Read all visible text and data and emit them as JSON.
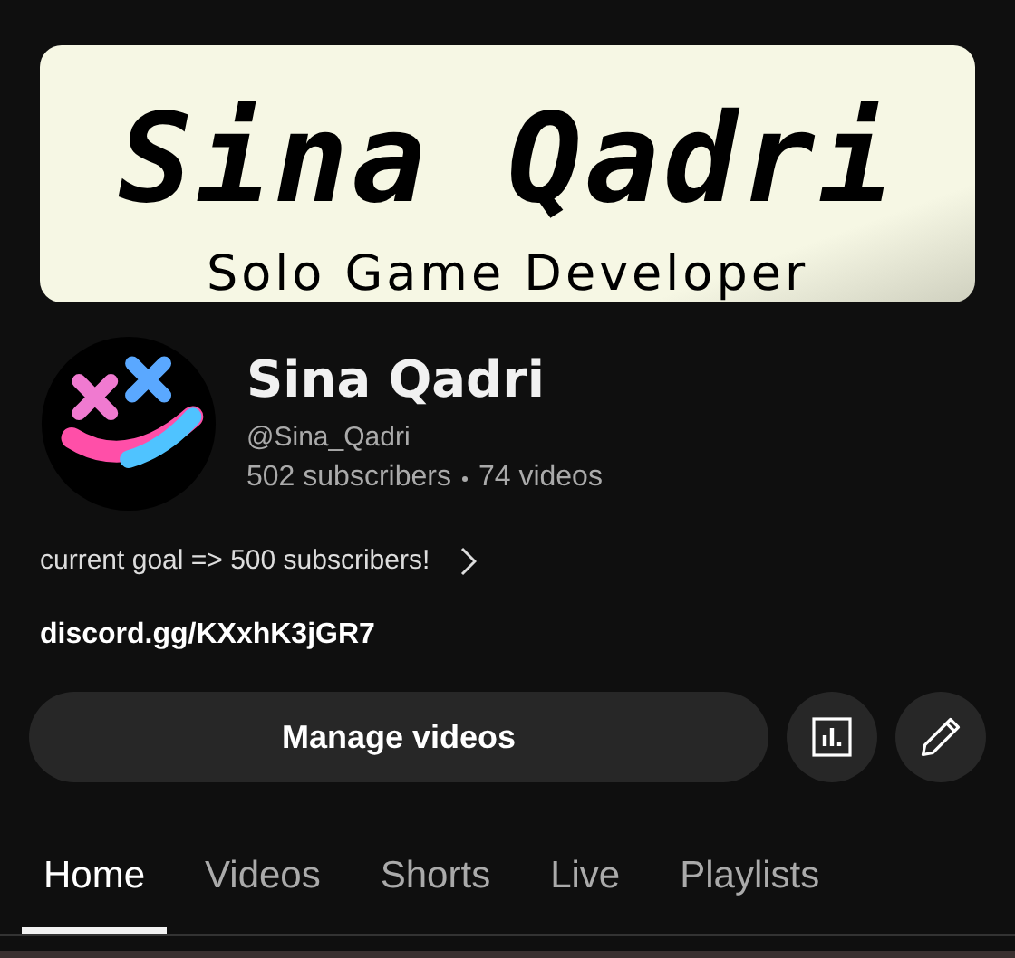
{
  "banner": {
    "title": "Sina Qadri",
    "subtitle": "Solo Game Developer"
  },
  "channel": {
    "name": "Sina Qadri",
    "handle": "@Sina_Qadri",
    "subscribers": "502 subscribers",
    "videos": "74 videos",
    "description": "current goal => 500 subscribers!",
    "link": "discord.gg/KXxhK3jGR7"
  },
  "actions": {
    "manage": "Manage videos"
  },
  "tabs": [
    {
      "label": "Home",
      "selected": true
    },
    {
      "label": "Videos",
      "selected": false
    },
    {
      "label": "Shorts",
      "selected": false
    },
    {
      "label": "Live",
      "selected": false
    },
    {
      "label": "Playlists",
      "selected": false
    }
  ]
}
